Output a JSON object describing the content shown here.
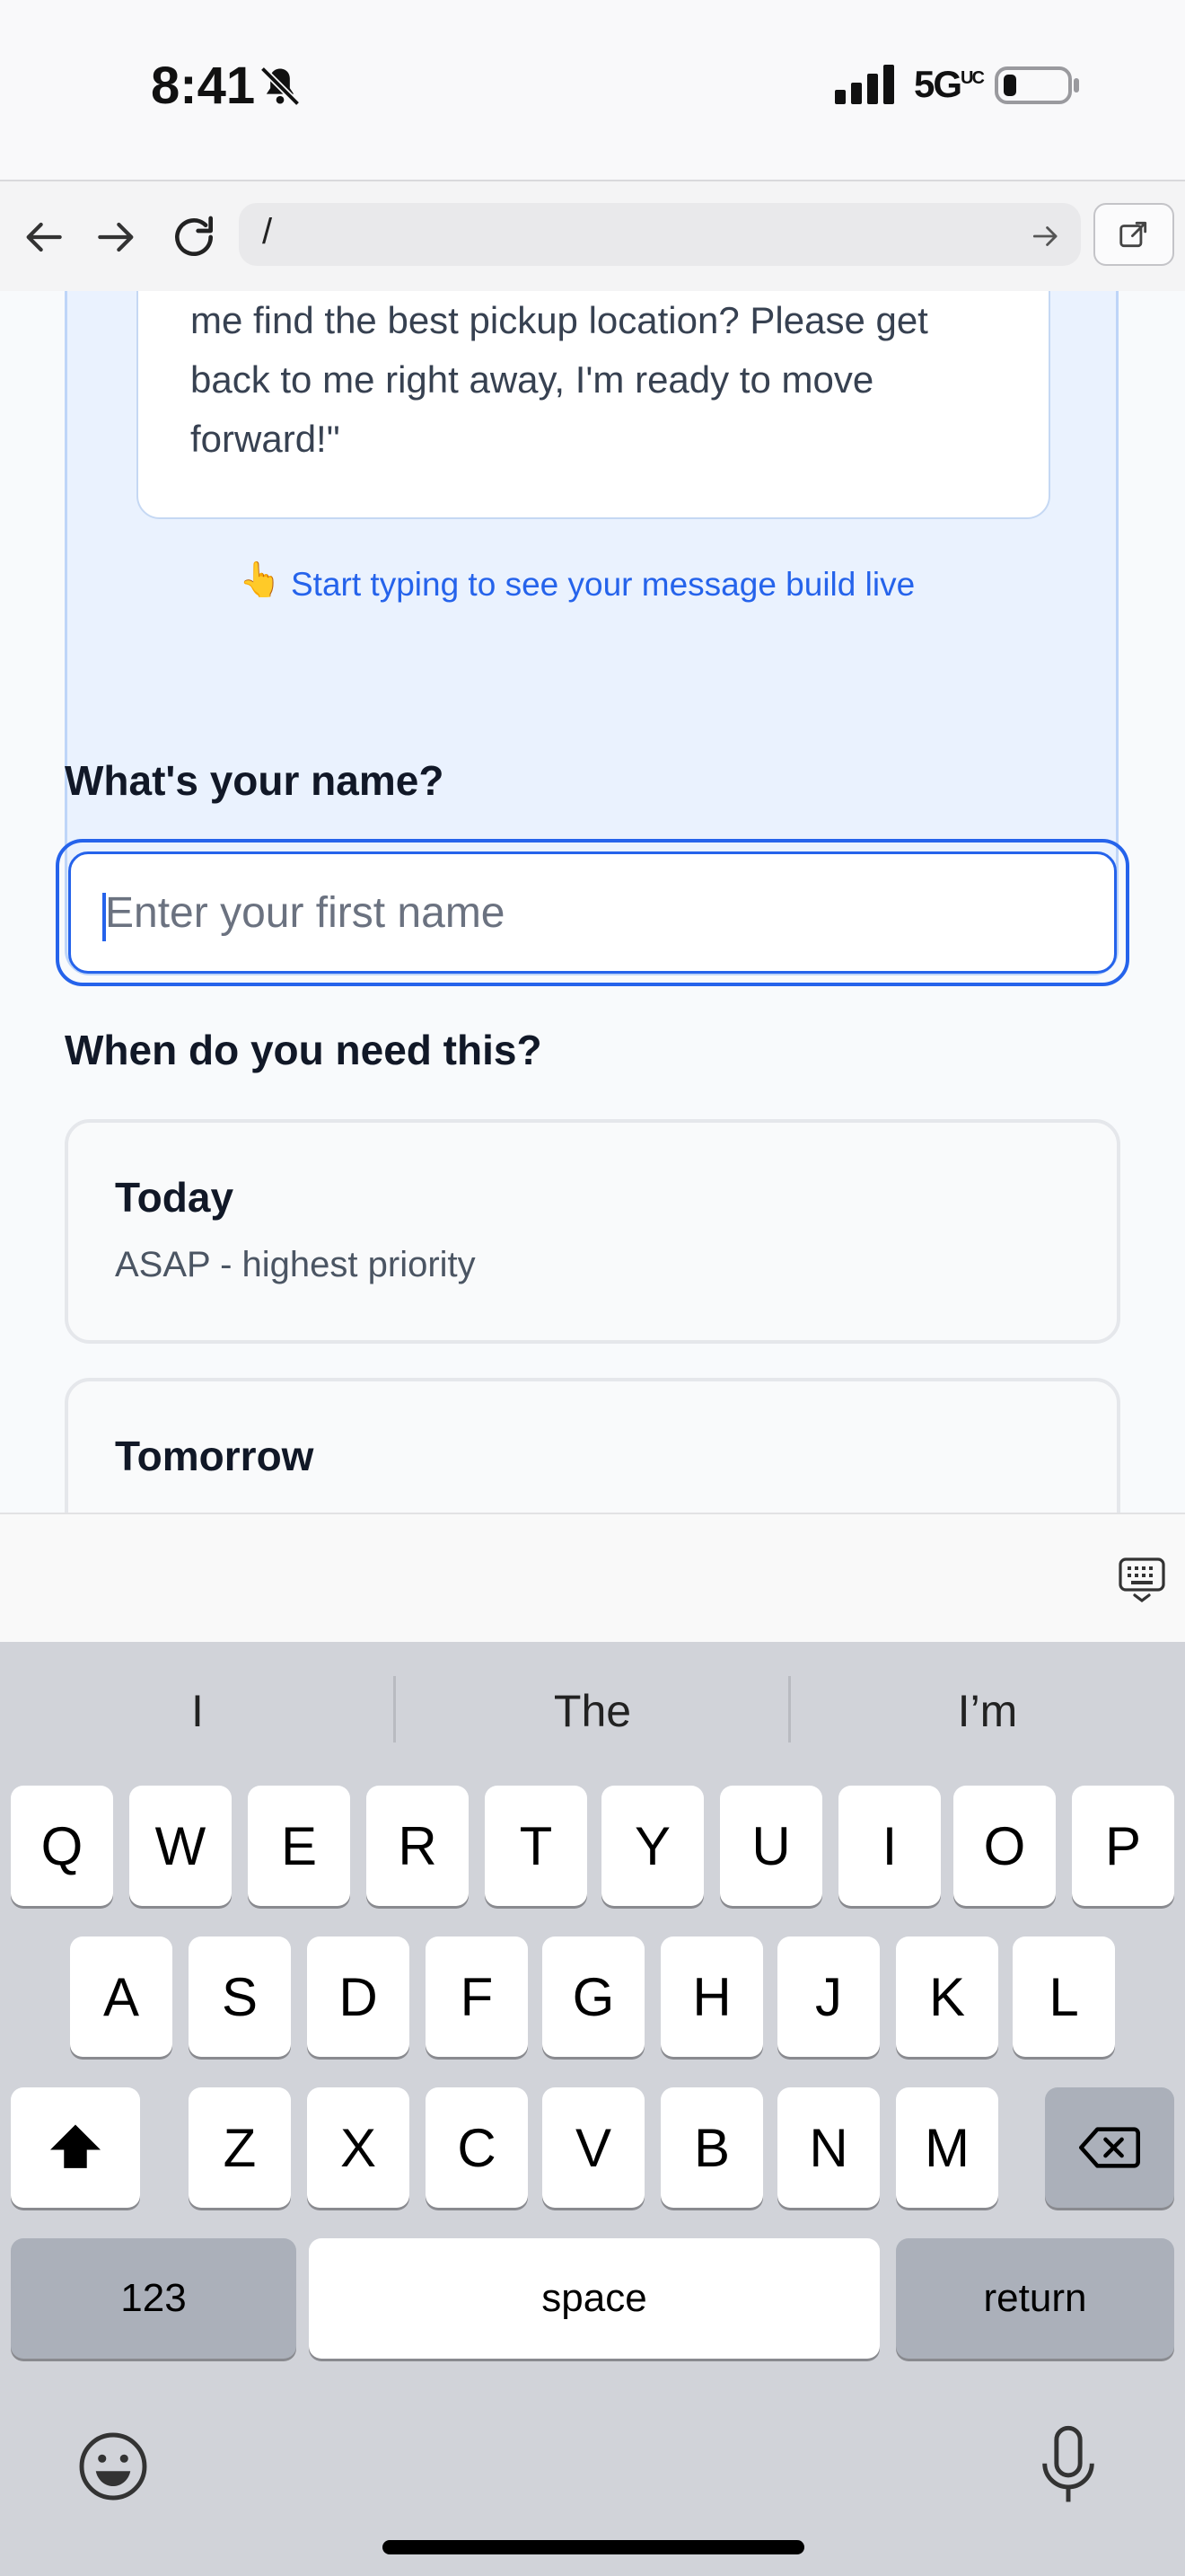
{
  "status_bar": {
    "time": "8:41",
    "network": "5G",
    "network_sup": "UC"
  },
  "browser": {
    "url": "/"
  },
  "preview": {
    "message": "me find the best pickup location? Please get back to me right away, I'm ready to move forward!\"",
    "hint_emoji": "👆",
    "hint": "Start typing to see your message build live"
  },
  "form": {
    "name_label": "What's your name?",
    "name_placeholder": "Enter your first name",
    "name_value": "",
    "when_label": "When do you need this?",
    "options": [
      {
        "title": "Today",
        "subtitle": "ASAP - highest priority"
      },
      {
        "title": "Tomorrow",
        "subtitle": ""
      }
    ]
  },
  "keyboard": {
    "suggestions": [
      "I",
      "The",
      "I’m"
    ],
    "row1": [
      "Q",
      "W",
      "E",
      "R",
      "T",
      "Y",
      "U",
      "I",
      "O",
      "P"
    ],
    "row2": [
      "A",
      "S",
      "D",
      "F",
      "G",
      "H",
      "J",
      "K",
      "L"
    ],
    "row3": [
      "Z",
      "X",
      "C",
      "V",
      "B",
      "N",
      "M"
    ],
    "numbers_label": "123",
    "space_label": "space",
    "return_label": "return"
  },
  "colors": {
    "accent": "#2563eb",
    "panel": "#eaf2fe",
    "keyboard": "#d1d3d9"
  }
}
